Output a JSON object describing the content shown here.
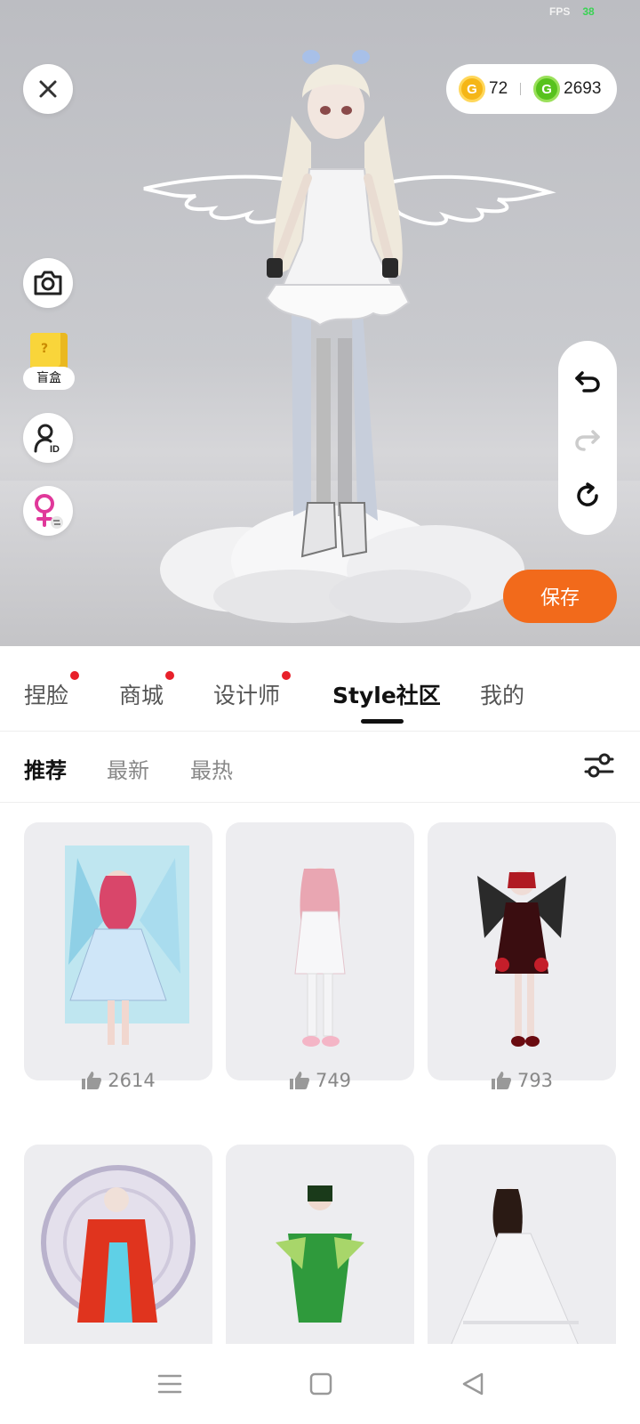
{
  "fps": {
    "label": "FPS",
    "value": "38"
  },
  "currency": {
    "gold_amount": "72",
    "green_amount": "2693"
  },
  "left_tools": {
    "blind_box_label": "盲盒"
  },
  "save_label": "保存",
  "tabs": [
    {
      "label": "捏脸",
      "dot": true
    },
    {
      "label": "商城",
      "dot": true
    },
    {
      "label": "设计师",
      "dot": true
    },
    {
      "label": "Style社区",
      "dot": false,
      "active": true
    },
    {
      "label": "我的",
      "dot": false
    }
  ],
  "subtabs": [
    {
      "label": "推荐",
      "active": true
    },
    {
      "label": "最新"
    },
    {
      "label": "最热"
    }
  ],
  "cards": [
    {
      "likes": "2614"
    },
    {
      "likes": "749"
    },
    {
      "likes": "793"
    },
    {
      "likes": ""
    },
    {
      "likes": ""
    },
    {
      "likes": ""
    }
  ],
  "colors": {
    "accent": "#f26a1b",
    "badge": "#e8202a",
    "gold": "#f5b617",
    "green": "#57c21d"
  },
  "icons": [
    "close-icon",
    "camera-icon",
    "user-id-icon",
    "female-gender-icon",
    "undo-icon",
    "redo-icon",
    "reset-icon",
    "filter-icon",
    "thumb-up-icon",
    "menu-icon",
    "home-icon",
    "back-icon"
  ]
}
